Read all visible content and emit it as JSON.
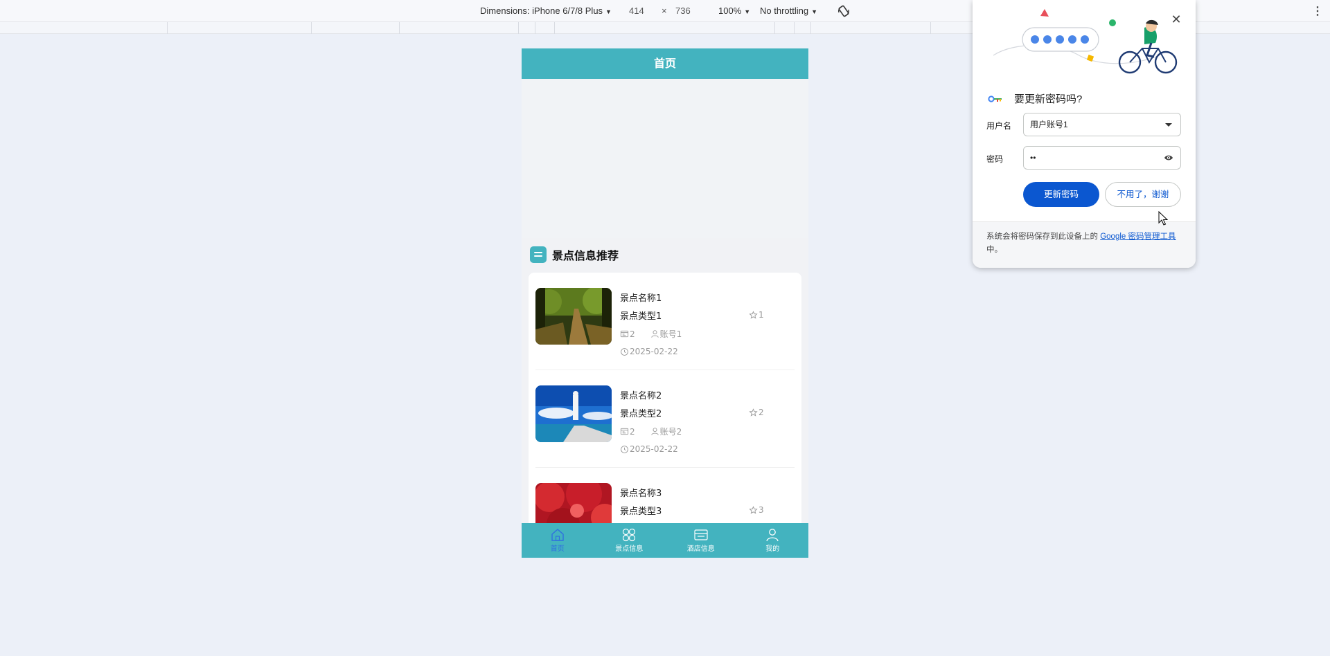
{
  "devtools": {
    "dimensions_label": "Dimensions: iPhone 6/7/8 Plus",
    "width": "414",
    "times": "×",
    "height": "736",
    "zoom": "100%",
    "throttling": "No throttling"
  },
  "app": {
    "header_title": "首页",
    "section_title": "景点信息推荐",
    "spots": [
      {
        "name": "景点名称1",
        "type": "景点类型1",
        "favorites": "1",
        "views": "2",
        "account": "账号1",
        "date": "2025-02-22"
      },
      {
        "name": "景点名称2",
        "type": "景点类型2",
        "favorites": "2",
        "views": "2",
        "account": "账号2",
        "date": "2025-02-22"
      },
      {
        "name": "景点名称3",
        "type": "景点类型3",
        "favorites": "3"
      }
    ],
    "tabs": [
      {
        "label": "首页",
        "icon": "home-icon",
        "active": true
      },
      {
        "label": "景点信息",
        "icon": "grid-icon",
        "active": false
      },
      {
        "label": "酒店信息",
        "icon": "hotel-icon",
        "active": false
      },
      {
        "label": "我的",
        "icon": "user-icon",
        "active": false
      }
    ]
  },
  "password_popup": {
    "title": "要更新密码吗?",
    "username_label": "用户名",
    "username_value": "用户账号1",
    "password_label": "密码",
    "password_value": "••",
    "update_button": "更新密码",
    "decline_button": "不用了，谢谢",
    "footer_text": "系统会将密码保存到此设备上的",
    "footer_link": "Google 密码管理工具",
    "footer_suffix": "中。"
  },
  "colors": {
    "app_teal": "#43b3bf",
    "primary_blue": "#0b57d0",
    "page_bg": "#ecf0f8"
  }
}
